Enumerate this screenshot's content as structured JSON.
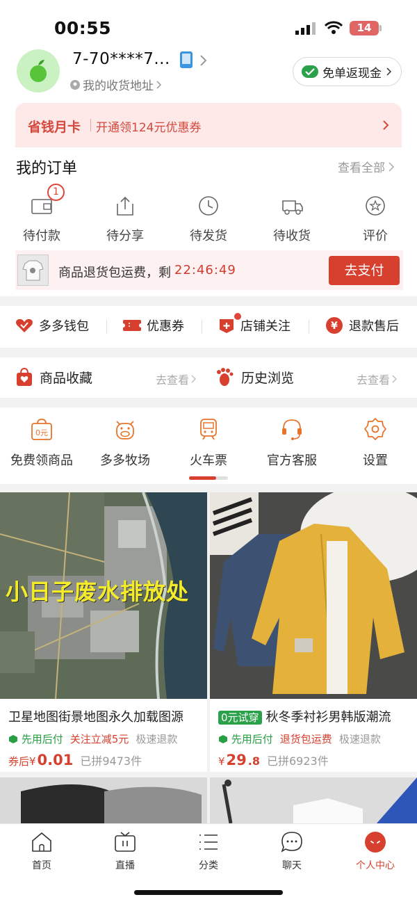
{
  "status_bar": {
    "time": "00:55",
    "battery": "14"
  },
  "header": {
    "username": "7-70****7...",
    "address_link": "我的收货地址",
    "cashback_label": "免单返现金"
  },
  "month_card": {
    "title": "省钱月卡",
    "desc": "开通领124元优惠券"
  },
  "orders": {
    "title": "我的订单",
    "view_all": "查看全部",
    "badge_count": "1",
    "items": [
      {
        "label": "待付款",
        "icon": "wallet-icon"
      },
      {
        "label": "待分享",
        "icon": "share-icon"
      },
      {
        "label": "待发货",
        "icon": "clock-icon"
      },
      {
        "label": "待收货",
        "icon": "truck-icon"
      },
      {
        "label": "评价",
        "icon": "star-icon"
      }
    ],
    "pending_payment": {
      "text": "商品退货包运费，剩",
      "countdown": "22:46:49",
      "button": "去支付"
    }
  },
  "shortcuts": [
    {
      "label": "多多钱包",
      "icon": "heart-wallet-icon"
    },
    {
      "label": "优惠券",
      "icon": "coupon-icon"
    },
    {
      "label": "店铺关注",
      "icon": "shop-plus-icon"
    },
    {
      "label": "退款售后",
      "icon": "yen-icon"
    }
  ],
  "favorites": [
    {
      "label": "商品收藏",
      "icon": "bag-icon",
      "action": "去查看"
    },
    {
      "label": "历史浏览",
      "icon": "footprint-icon",
      "action": "去查看"
    }
  ],
  "tools": [
    {
      "label": "免费领商品",
      "icon": "free-bag-icon",
      "icon_text": "0元"
    },
    {
      "label": "多多牧场",
      "icon": "cow-icon"
    },
    {
      "label": "火车票",
      "icon": "train-icon"
    },
    {
      "label": "官方客服",
      "icon": "headset-icon"
    },
    {
      "label": "设置",
      "icon": "settings-icon"
    }
  ],
  "tools_scroll_progress": 0.7,
  "products": [
    {
      "title": "卫星地图街景地图永久加载图源",
      "overlay": "小日子废水排放处",
      "tags": [
        "先用后付",
        "关注立减5元",
        "极速退款"
      ],
      "price_prefix": "券后¥",
      "price": "0.01",
      "sold": "已拼9473件"
    },
    {
      "badge": "0元试穿",
      "title": "秋冬季衬衫男韩版潮流",
      "tags": [
        "先用后付",
        "退货包运费",
        "极速退款"
      ],
      "price_prefix": "¥",
      "price": "29",
      "price_decimal": ".8",
      "sold": "已拼6923件"
    }
  ],
  "bottom_nav": [
    {
      "label": "首页",
      "icon": "home-icon"
    },
    {
      "label": "直播",
      "icon": "tv-icon"
    },
    {
      "label": "分类",
      "icon": "list-icon"
    },
    {
      "label": "聊天",
      "icon": "chat-icon"
    },
    {
      "label": "个人中心",
      "icon": "profile-icon",
      "active": true
    }
  ],
  "colors": {
    "accent": "#d7402f",
    "green": "#27a043",
    "card_pink": "#fde9e8"
  }
}
